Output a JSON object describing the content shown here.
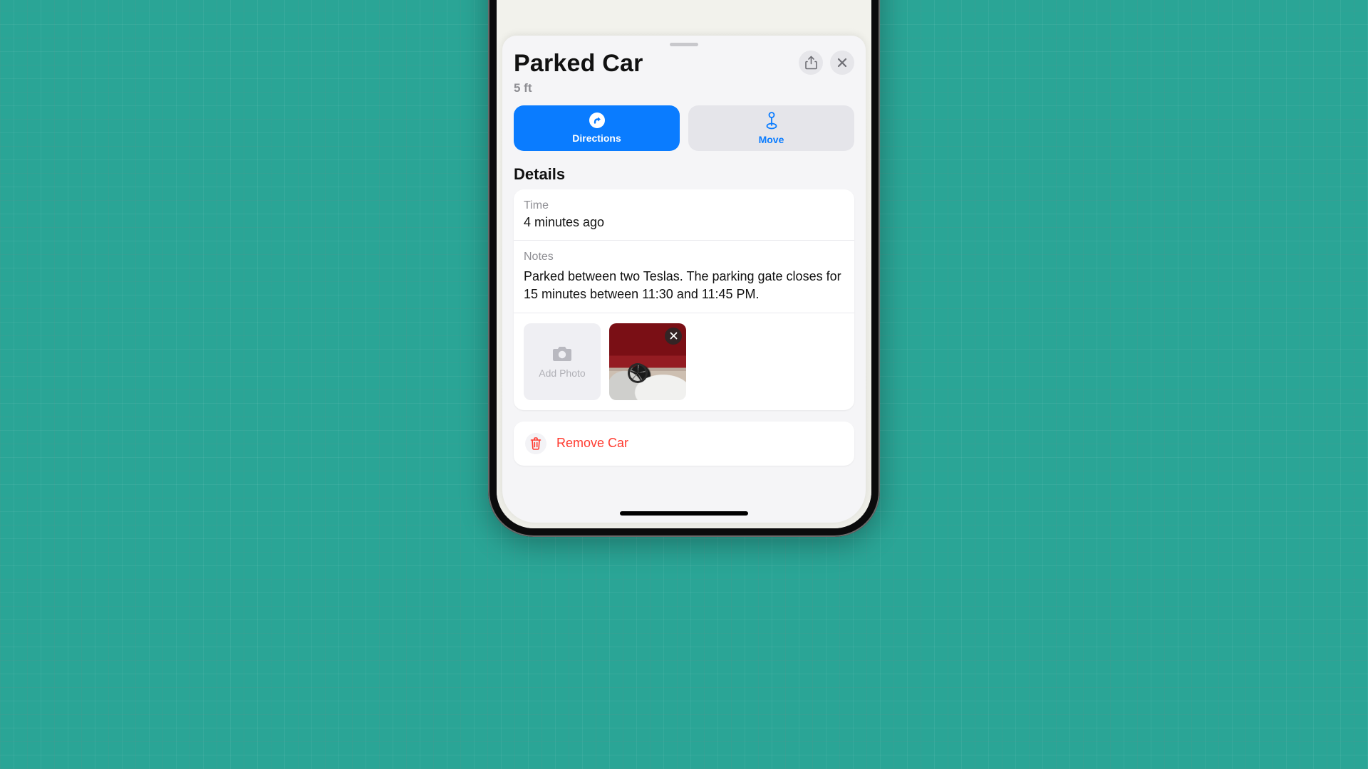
{
  "header": {
    "title": "Parked Car",
    "distance": "5 ft"
  },
  "actions": {
    "directions_label": "Directions",
    "move_label": "Move"
  },
  "details": {
    "heading": "Details",
    "time": {
      "label": "Time",
      "value": "4 minutes ago"
    },
    "notes": {
      "label": "Notes",
      "value": "Parked between two Teslas. The parking gate closes for 15 minutes between 11:30 and 11:45 PM."
    },
    "add_photo_label": "Add Photo"
  },
  "remove": {
    "label": "Remove Car"
  },
  "colors": {
    "accent": "#0a7cff",
    "destructive": "#ff3b30"
  }
}
